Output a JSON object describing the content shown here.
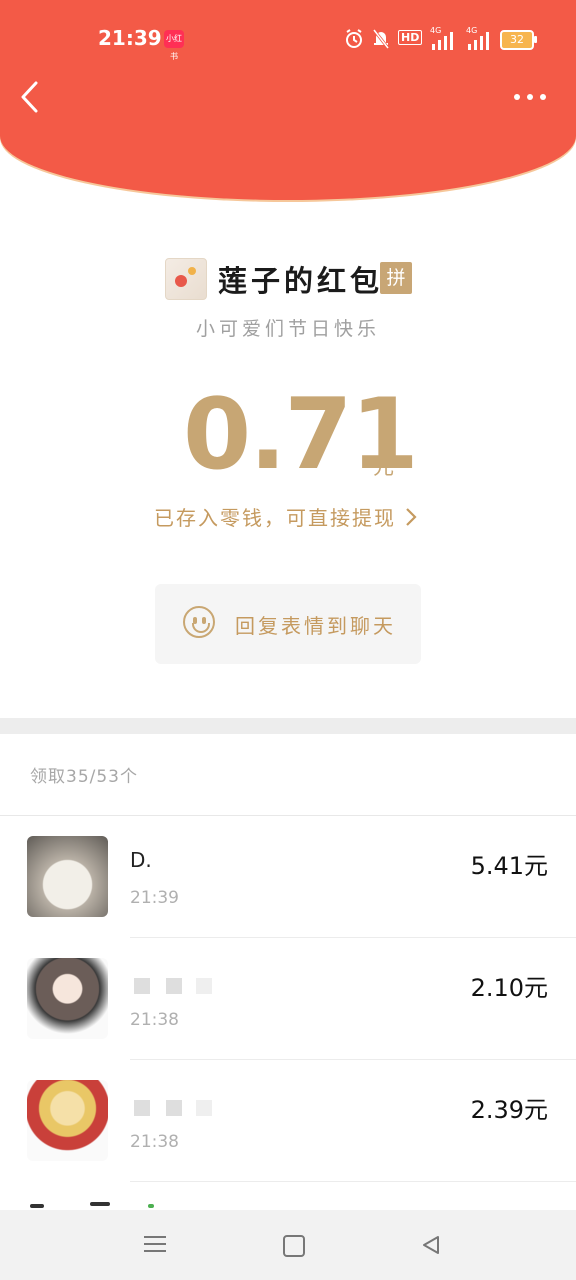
{
  "status_bar": {
    "time": "21:39",
    "app_badge": "小红书",
    "hd_label": "HD",
    "net_label_1": "4G",
    "net_label_2": "4G",
    "battery": "32"
  },
  "packet": {
    "sender_name": "莲子的红包",
    "pin_label": "拼",
    "blessing": "小可爱们节日快乐",
    "amount": "0.71",
    "unit": "元",
    "saved_text": "已存入零钱，可直接提现",
    "reply_text": "回复表情到聊天"
  },
  "claims": {
    "summary": "领取35/53个",
    "items": [
      {
        "name": "D.",
        "time": "21:39",
        "amount": "5.41元",
        "avatar_icon": "rabbit-avatar"
      },
      {
        "name": "",
        "time": "21:38",
        "amount": "2.10元",
        "avatar_icon": "anime-girl-avatar"
      },
      {
        "name": "",
        "time": "21:38",
        "amount": "2.39元",
        "avatar_icon": "anime-cat-girl-avatar"
      }
    ]
  },
  "colors": {
    "header_red": "#f35a47",
    "gold": "#c7a674"
  }
}
